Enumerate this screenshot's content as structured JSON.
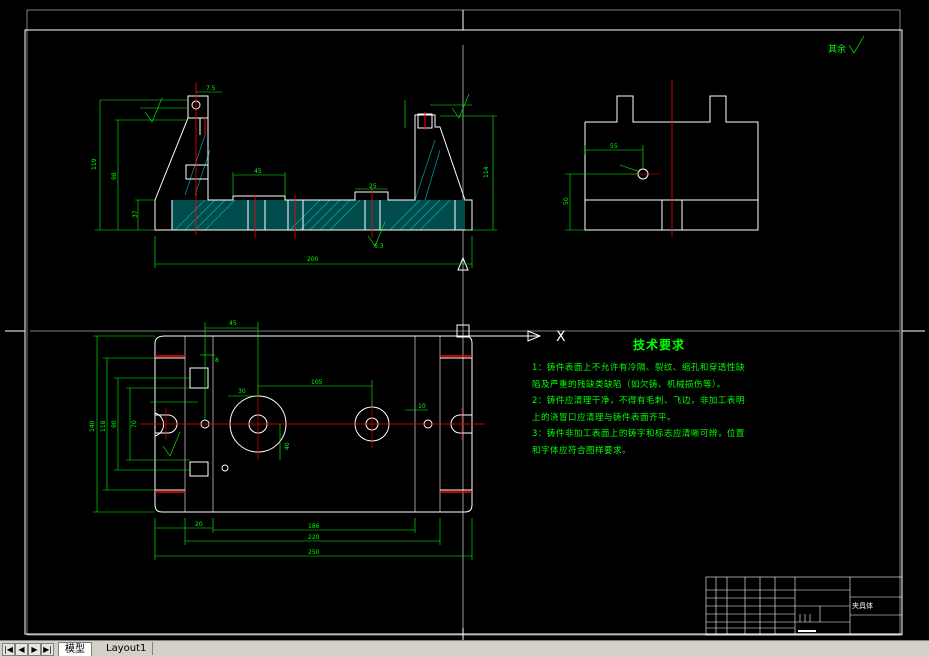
{
  "notes": {
    "title": "技术要求",
    "lines": [
      "1：铸件表面上不允许有冷隔、裂纹、缩孔和穿透性缺",
      "陷及严重的残缺类缺陷（如欠铸、机械损伤等）。",
      "2：铸件应清理干净，不得有毛刺、飞边，非加工表明",
      "上的浇冒口应清理与铸件表面齐平。",
      "3：铸件非加工表面上的铸字和标志应清晰可辨，位置",
      "和字体应符合图样要求。"
    ]
  },
  "roughness_note": "其余",
  "title_block": {
    "drawing_name": "夹具体"
  },
  "tabs": {
    "model": "模型",
    "layout": "Layout1"
  },
  "nav": [
    "|◀",
    "◀",
    "▶",
    "▶|"
  ],
  "dimensions": {
    "front_top": "7.5",
    "front_118": "119",
    "front_98": "98",
    "front_37": "37",
    "front_45": "45",
    "front_25": "25",
    "front_114": "114",
    "front_200": "200",
    "front_63": "6.3",
    "side_55": "55",
    "side_50": "50",
    "plan_45": "45",
    "plan_8": "8",
    "plan_30": "30",
    "plan_105": "105",
    "plan_40": "40",
    "plan_10": "10",
    "plan_20": "20",
    "plan_186": "186",
    "plan_220": "220",
    "plan_250": "250",
    "plan_140": "140",
    "plan_118": "118",
    "plan_90": "90",
    "plan_70": "70",
    "axis_x": "X"
  },
  "colors": {
    "outline": "#ffffff",
    "dimension": "#00ff00",
    "center": "#ff0000",
    "hatch": "#00c8c8",
    "frame": "#ffffff"
  }
}
